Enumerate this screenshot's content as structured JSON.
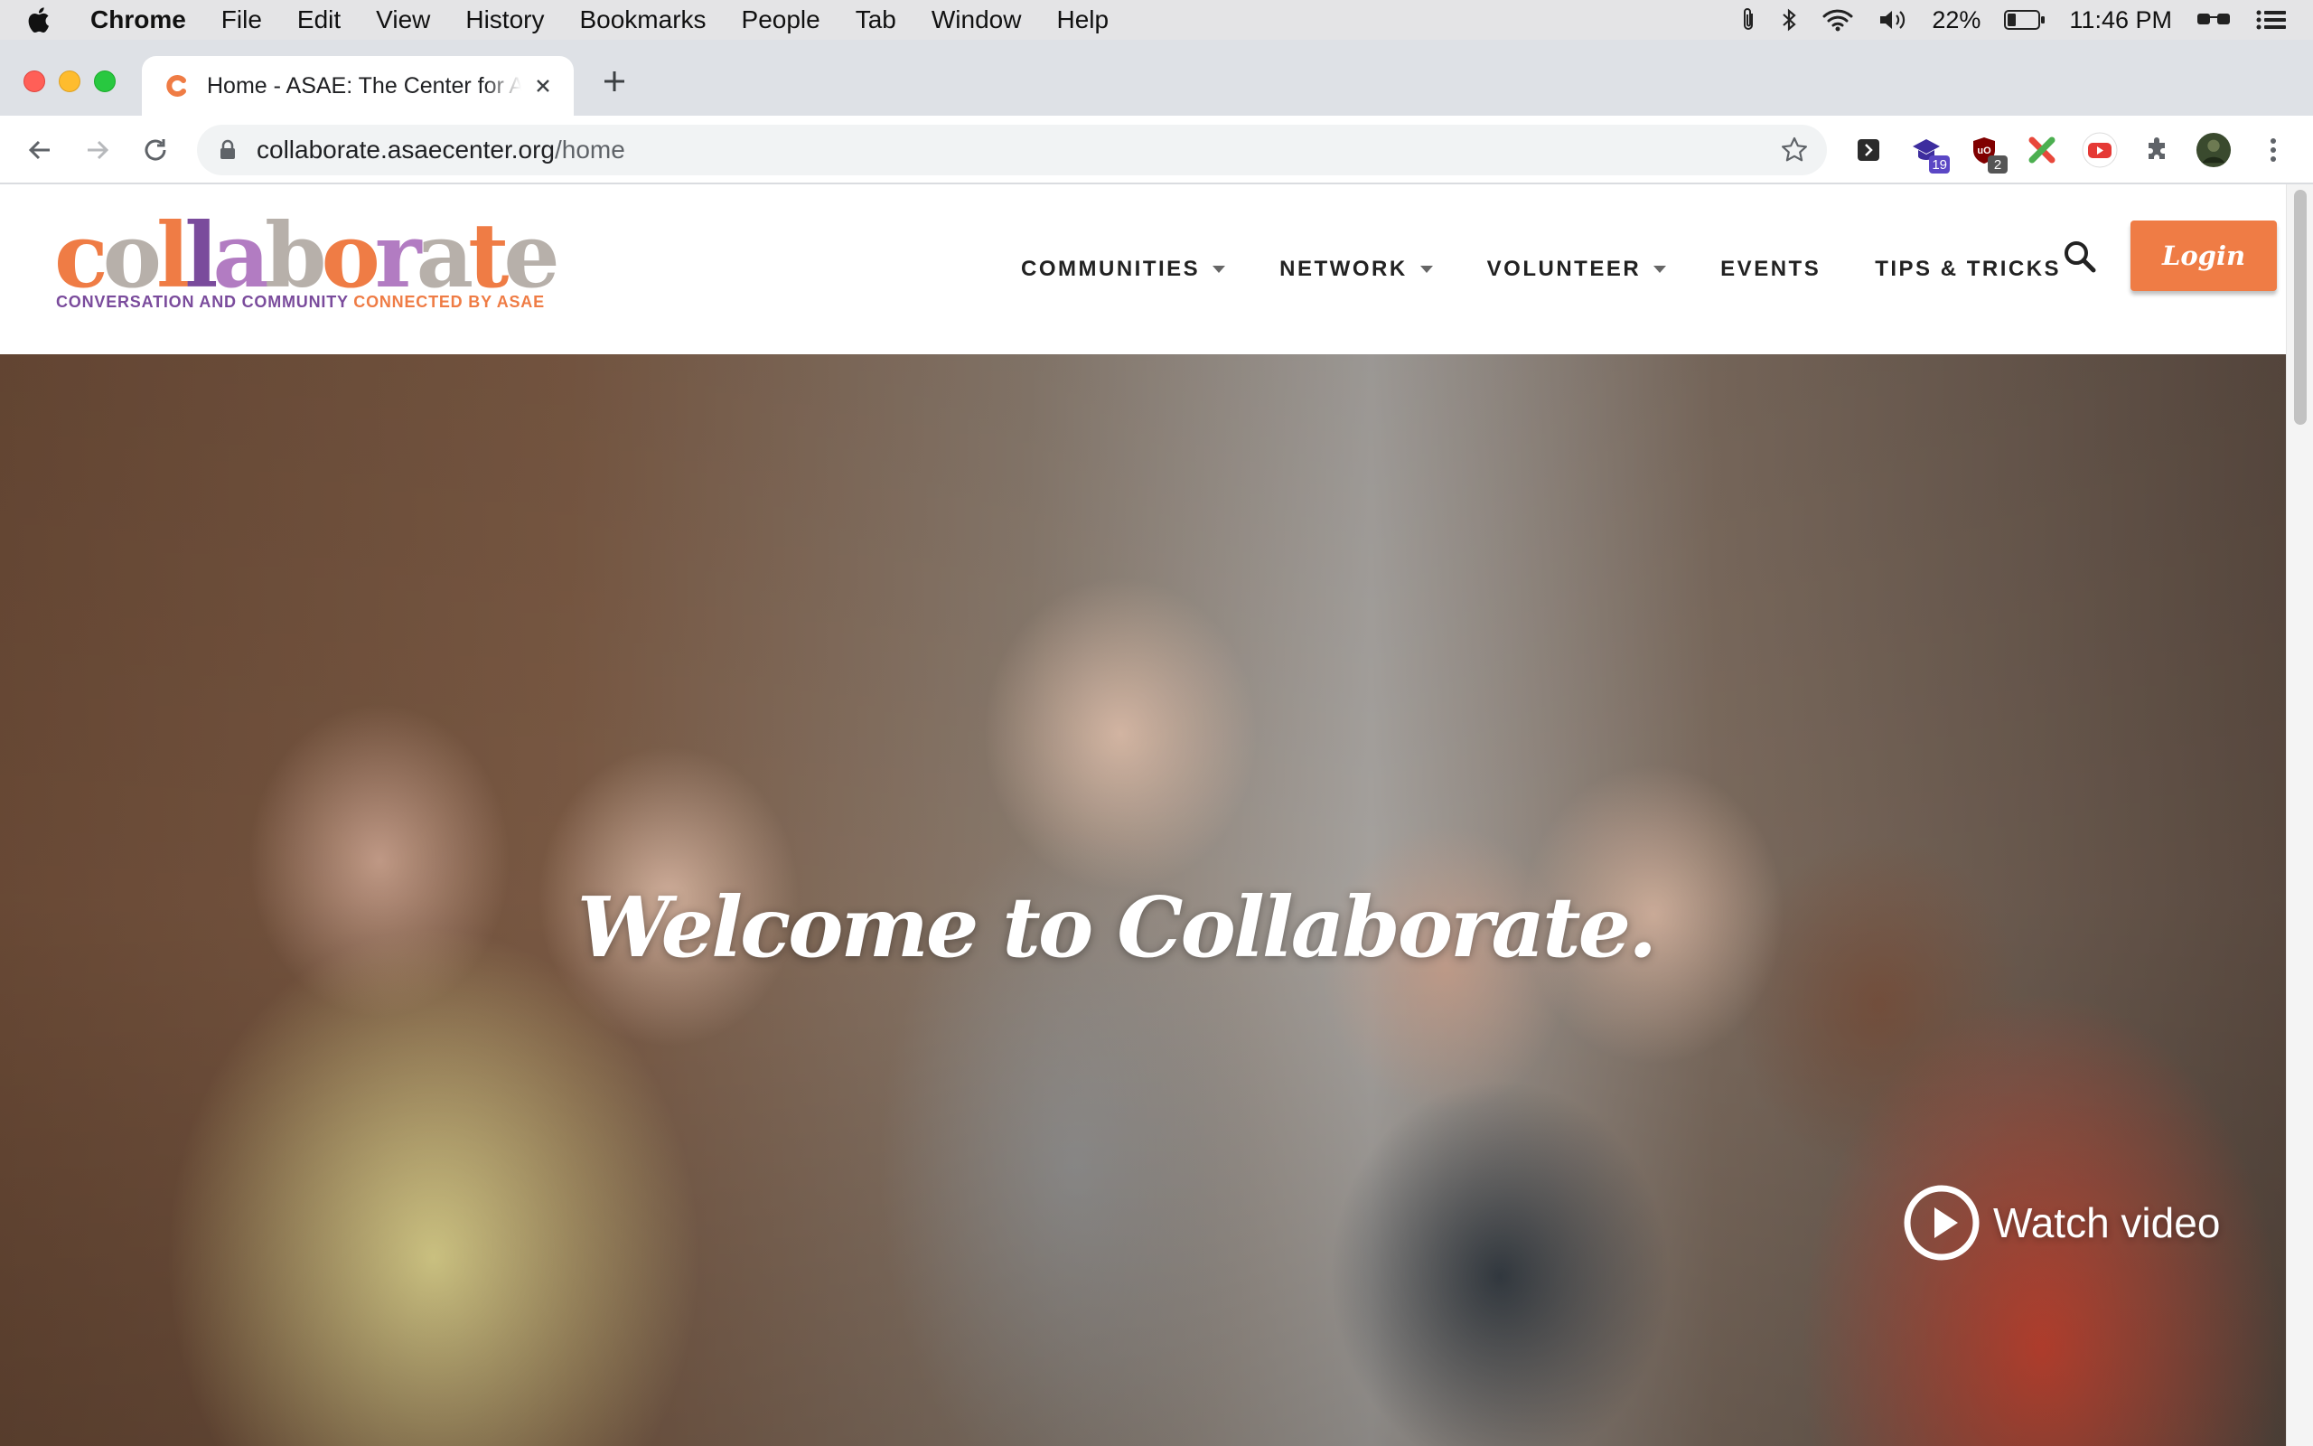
{
  "menubar": {
    "app": "Chrome",
    "items": [
      "File",
      "Edit",
      "View",
      "History",
      "Bookmarks",
      "People",
      "Tab",
      "Window",
      "Help"
    ],
    "battery": "22%",
    "clock": "11:46 PM"
  },
  "tab": {
    "title": "Home - ASAE: The Center for Association Leadership"
  },
  "address_bar": {
    "host": "collaborate.asaecenter.org",
    "path": "/home"
  },
  "extensions": {
    "badge_1": "19",
    "badge_2": "2"
  },
  "site": {
    "logo_text": "collaborate",
    "tagline_part1": "CONVERSATION AND COMMUNITY ",
    "tagline_part2": "CONNECTED BY ASAE",
    "nav": {
      "communities": "COMMUNITIES",
      "network": "NETWORK",
      "volunteer": "VOLUNTEER",
      "events": "EVENTS",
      "tips": "TIPS & TRICKS"
    },
    "login": "Login"
  },
  "hero": {
    "headline": "Welcome to Collaborate.",
    "watch_video": "Watch video"
  },
  "colors": {
    "brand_orange": "#ef7c45",
    "brand_purple": "#7a4b9c",
    "logo_gray": "#b7b0aa",
    "logo_violet": "#b27cc2"
  }
}
